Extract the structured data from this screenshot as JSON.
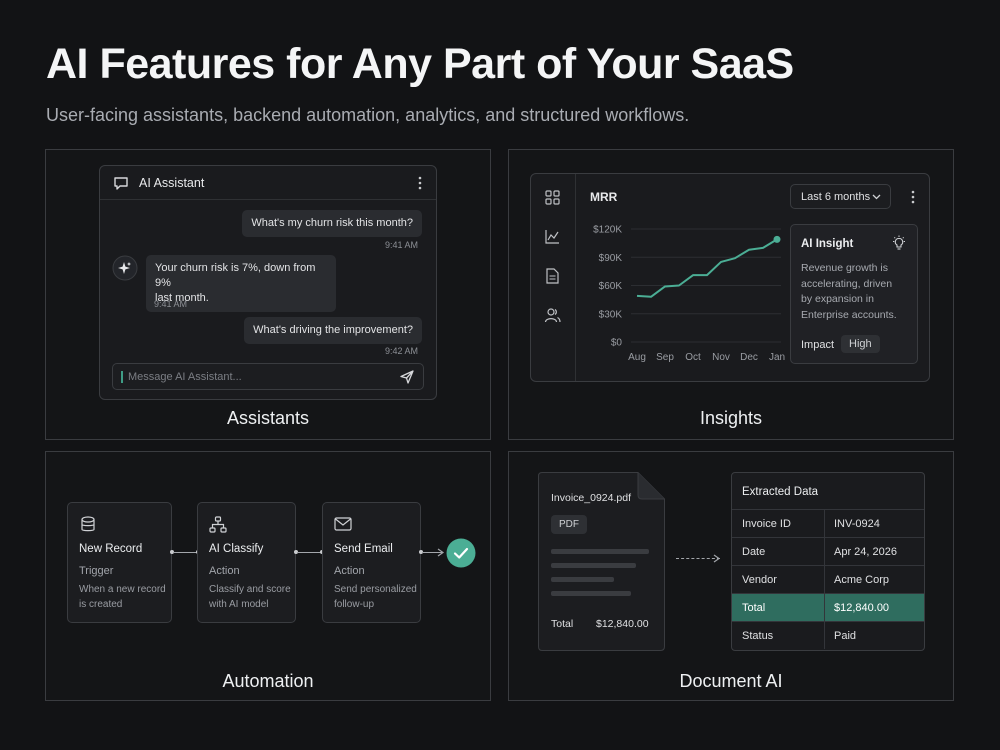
{
  "header": {
    "title": "AI Features for Any Part of Your SaaS",
    "subtitle": "User-facing assistants, backend automation, analytics, and structured workflows."
  },
  "colors": {
    "accent": "#4bae95",
    "highlight_row": "#2f6d5f",
    "background": "#121315"
  },
  "assistants": {
    "label": "Assistants",
    "chat_title": "AI Assistant",
    "messages": [
      {
        "from": "user",
        "text": "What's my churn risk this month?",
        "time": "9:41 AM"
      },
      {
        "from": "ai",
        "text_line1": "Your churn risk is 7%, down from 9%",
        "text_line2": "last month.",
        "time": "9:41 AM"
      },
      {
        "from": "user",
        "text": "What's driving the improvement?",
        "time": "9:42 AM"
      }
    ],
    "input_placeholder": "Message AI Assistant..."
  },
  "insights": {
    "label": "Insights",
    "metric": "MRR",
    "range_dropdown": "Last 6 months",
    "insight_title": "AI Insight",
    "insight_lines": [
      "Revenue growth is",
      "accelerating, driven",
      "by expansion in",
      "Enterprise accounts."
    ],
    "impact_label": "Impact",
    "impact_value": "High",
    "nav_icons": [
      "grid-icon",
      "chart-line-icon",
      "document-icon",
      "users-icon"
    ]
  },
  "chart_data": {
    "type": "line",
    "x": [
      "Aug",
      "",
      "Sep",
      "",
      "Oct",
      "",
      "Nov",
      "",
      "Dec",
      "",
      "Jan"
    ],
    "series": [
      {
        "values": [
          49000,
          48000,
          59000,
          60000,
          71000,
          71000,
          85000,
          89000,
          98000,
          100000,
          109000
        ]
      }
    ],
    "x_tick_labels": [
      "Aug",
      "Sep",
      "Oct",
      "Nov",
      "Dec",
      "Jan"
    ],
    "y_tick_labels": [
      "$120K",
      "$90K",
      "$60K",
      "$30K",
      "$0"
    ],
    "ylim": [
      0,
      120000
    ],
    "title": "MRR",
    "xlabel": "",
    "ylabel": "",
    "grid": "horizontal"
  },
  "automation": {
    "label": "Automation",
    "nodes": [
      {
        "icon": "database-icon",
        "title": "New Record",
        "kind": "Trigger",
        "desc_line1": "When a new record",
        "desc_line2": "is created"
      },
      {
        "icon": "flow-icon",
        "title": "AI Classify",
        "kind": "Action",
        "desc_line1": "Classify and score",
        "desc_line2": "with AI model"
      },
      {
        "icon": "mail-icon",
        "title": "Send Email",
        "kind": "Action",
        "desc_line1": "Send personalized",
        "desc_line2": "follow-up"
      }
    ]
  },
  "document_ai": {
    "label": "Document AI",
    "filename": "Invoice_0924.pdf",
    "badge": "PDF",
    "total_label": "Total",
    "total_value": "$12,840.00",
    "extracted_title": "Extracted Data",
    "rows": [
      {
        "key": "Invoice ID",
        "value": "INV-0924"
      },
      {
        "key": "Date",
        "value": "Apr 24, 2026"
      },
      {
        "key": "Vendor",
        "value": "Acme Corp"
      },
      {
        "key": "Total",
        "value": "$12,840.00"
      },
      {
        "key": "Status",
        "value": "Paid"
      }
    ]
  }
}
